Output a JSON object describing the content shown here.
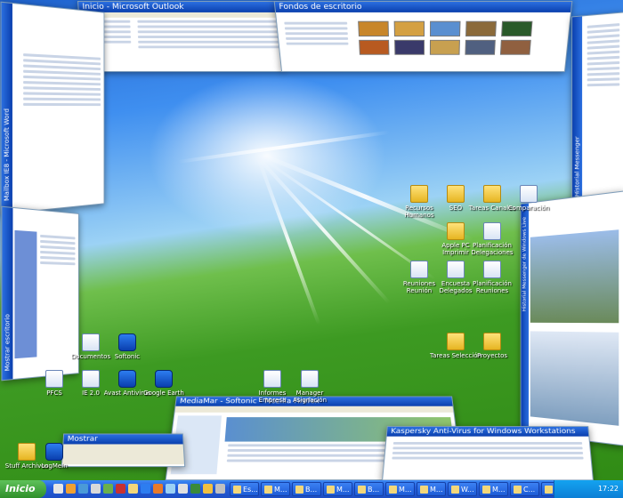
{
  "top_windows": {
    "outlook_title": "Inicio - Microsoft Outlook",
    "wallpaper_title": "Fondos de escritorio"
  },
  "side_titles": {
    "left_word": "Mailbox IE8 - Microsoft Word",
    "left_explorer": "Mostrar escritorio",
    "right_panel": "Historial Messenger",
    "right_ns": "Historial Messenger de Windows Live"
  },
  "bottom_windows": {
    "firefox_title": "MediaMar - Softonic - Mozilla Firefox",
    "kaspersky_title": "Kaspersky Anti-Virus for Windows Workstations",
    "small_title": "Mostrar"
  },
  "desktop_icons": {
    "right": [
      {
        "name": "folder-icon",
        "label": "Recursos Humanos",
        "kind": "folder"
      },
      {
        "name": "folder-icon",
        "label": "SEO",
        "kind": "folder"
      },
      {
        "name": "folder-icon",
        "label": "Tareas Canales",
        "kind": "folder"
      },
      {
        "name": "document-icon",
        "label": "Comparación",
        "kind": "doc"
      },
      {
        "name": "folder-icon",
        "label": "Apple PC Imprimir",
        "kind": "folder"
      },
      {
        "name": "document-icon",
        "label": "Planificación Delegaciones",
        "kind": "doc"
      },
      {
        "name": "document-icon",
        "label": "Reuniones Reunión",
        "kind": "doc"
      },
      {
        "name": "document-icon",
        "label": "Encuesta Delegados",
        "kind": "doc"
      },
      {
        "name": "document-icon",
        "label": "Planificación Reuniones",
        "kind": "doc"
      },
      {
        "name": "folder-icon",
        "label": "Tareas Selección",
        "kind": "folder"
      },
      {
        "name": "folder-icon",
        "label": "Proyectos",
        "kind": "folder"
      }
    ],
    "left": [
      {
        "name": "document-icon",
        "label": "Documentos",
        "kind": "doc"
      },
      {
        "name": "app-icon",
        "label": "Softonic",
        "kind": "app"
      },
      {
        "name": "document-icon",
        "label": "PFCS",
        "kind": "doc"
      },
      {
        "name": "document-icon",
        "label": "IE 2.0",
        "kind": "doc"
      },
      {
        "name": "app-icon",
        "label": "Avast Antivirus",
        "kind": "app"
      },
      {
        "name": "app-icon",
        "label": "Google Earth",
        "kind": "app"
      },
      {
        "name": "document-icon",
        "label": "Informes Empresa",
        "kind": "doc"
      },
      {
        "name": "document-icon",
        "label": "Manager Asignación",
        "kind": "doc"
      },
      {
        "name": "folder-icon",
        "label": "Stuff Archivos",
        "kind": "folder"
      },
      {
        "name": "app-icon",
        "label": "LogMeIn",
        "kind": "app"
      }
    ]
  },
  "taskbar": {
    "start_label": "Inicio",
    "buttons": [
      "Es...",
      "M...",
      "B...",
      "M...",
      "B...",
      "M...",
      "M...",
      "W...",
      "M...",
      "C...",
      "K...",
      "R...",
      "P..."
    ],
    "clock": "17:22"
  },
  "colors": {
    "taskbar": "#245edb",
    "start": "#2f8f2a",
    "titlebar": "#0a3fae",
    "tray": "#0c7fd6"
  }
}
